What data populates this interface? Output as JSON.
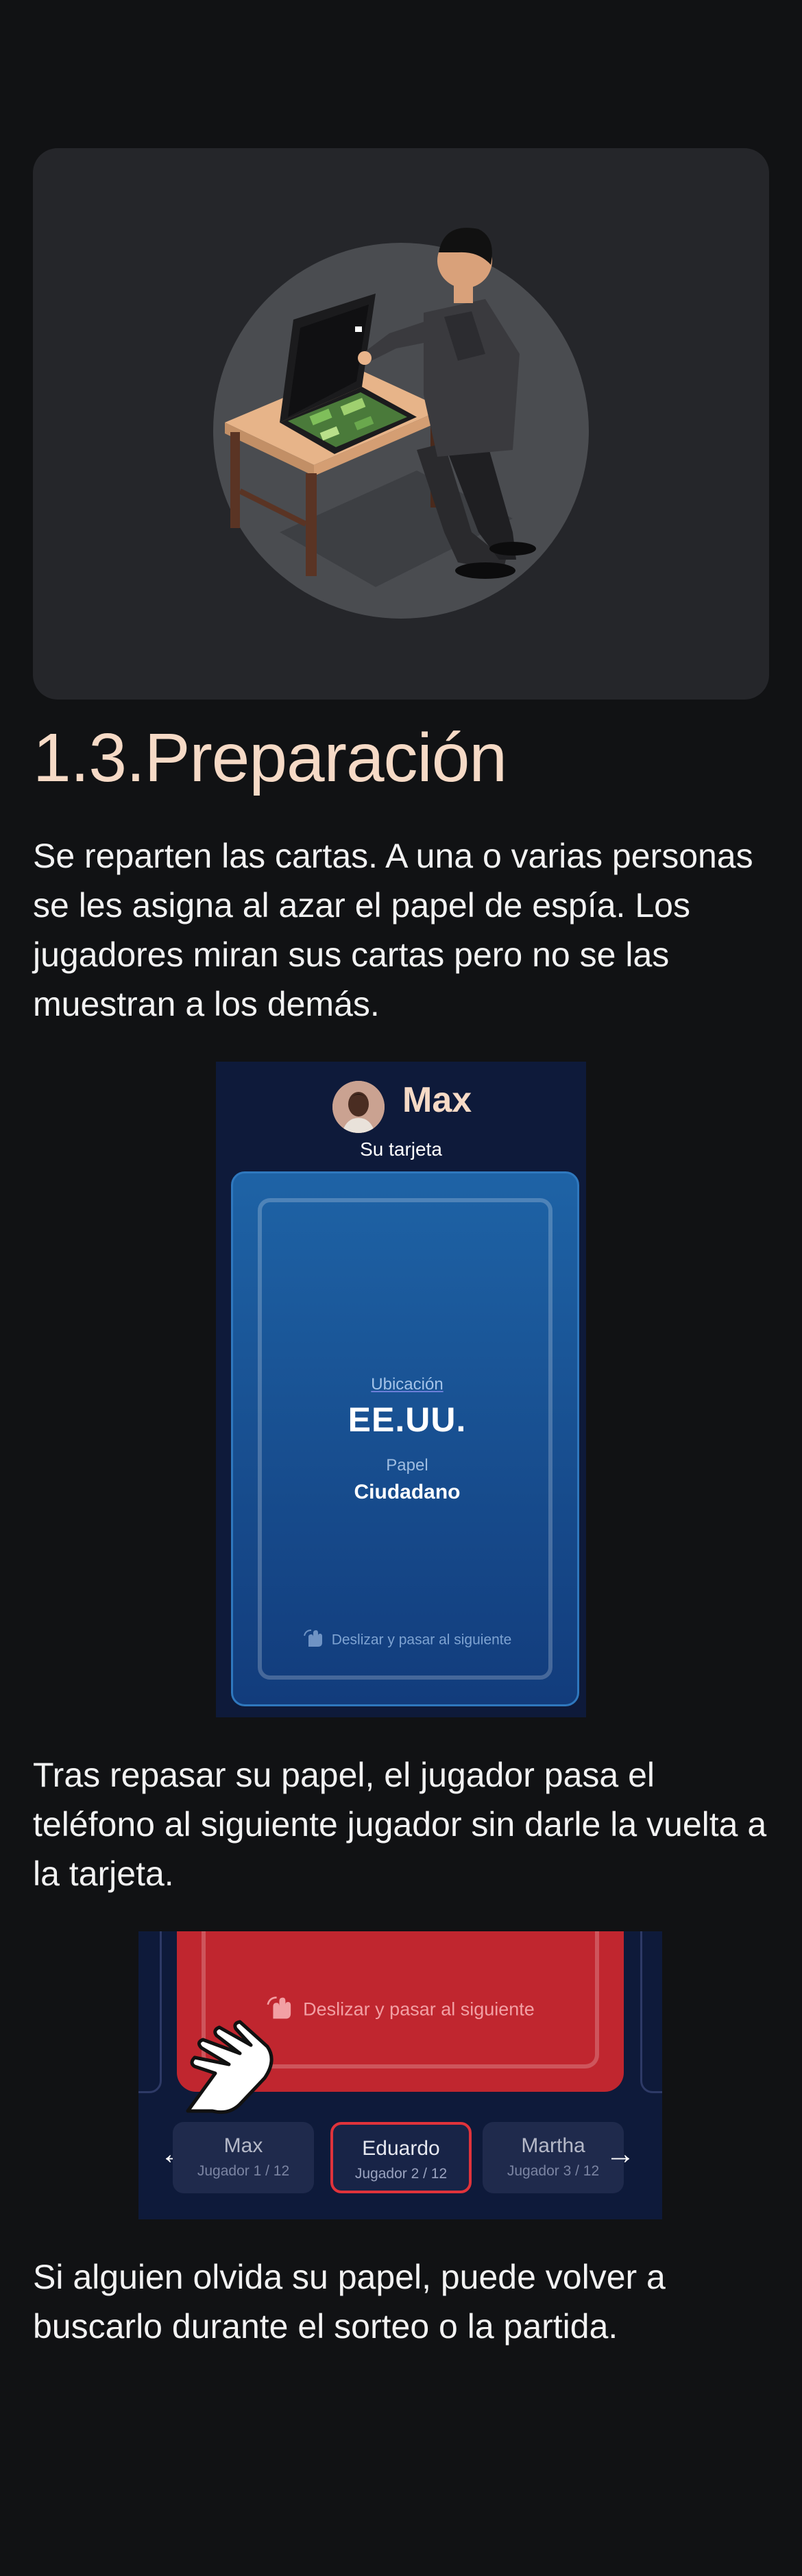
{
  "section": {
    "title": "1.3.Preparación",
    "intro": "Se reparten las cartas. A una o varias personas se les asigna al azar el papel de espía. Los jugadores miran sus cartas pero no se las muestran a los demás.",
    "after_card": "Tras repasar su papel, el jugador pasa el teléfono al siguiente jugador sin darle la vuelta a la tarjeta.",
    "footer": "Si alguien olvida su papel, puede volver a buscarlo durante el sorteo o la partida."
  },
  "card_screen": {
    "player_name": "Max",
    "subtitle": "Su tarjeta",
    "location_label": "Ubicación",
    "location_value": "EE.UU.",
    "role_label": "Papel",
    "role_value": "Ciudadano",
    "swipe_hint": "Deslizar y pasar al siguiente"
  },
  "switch_screen": {
    "swipe_hint": "Deslizar y pasar al siguiente",
    "prev_icon": "arrow-left-icon",
    "next_icon": "arrow-right-icon",
    "players": [
      {
        "name": "Max",
        "sub": "Jugador 1 / 12"
      },
      {
        "name": "Eduardo",
        "sub": "Jugador 2 / 12"
      },
      {
        "name": "Martha",
        "sub": "Jugador 3 / 12"
      }
    ],
    "selected_index": 1
  },
  "colors": {
    "background": "#111214",
    "title": "#f6dac6",
    "card_blue": "#1e63a6",
    "card_red": "#c0262f",
    "accent_red": "#e0333b"
  }
}
